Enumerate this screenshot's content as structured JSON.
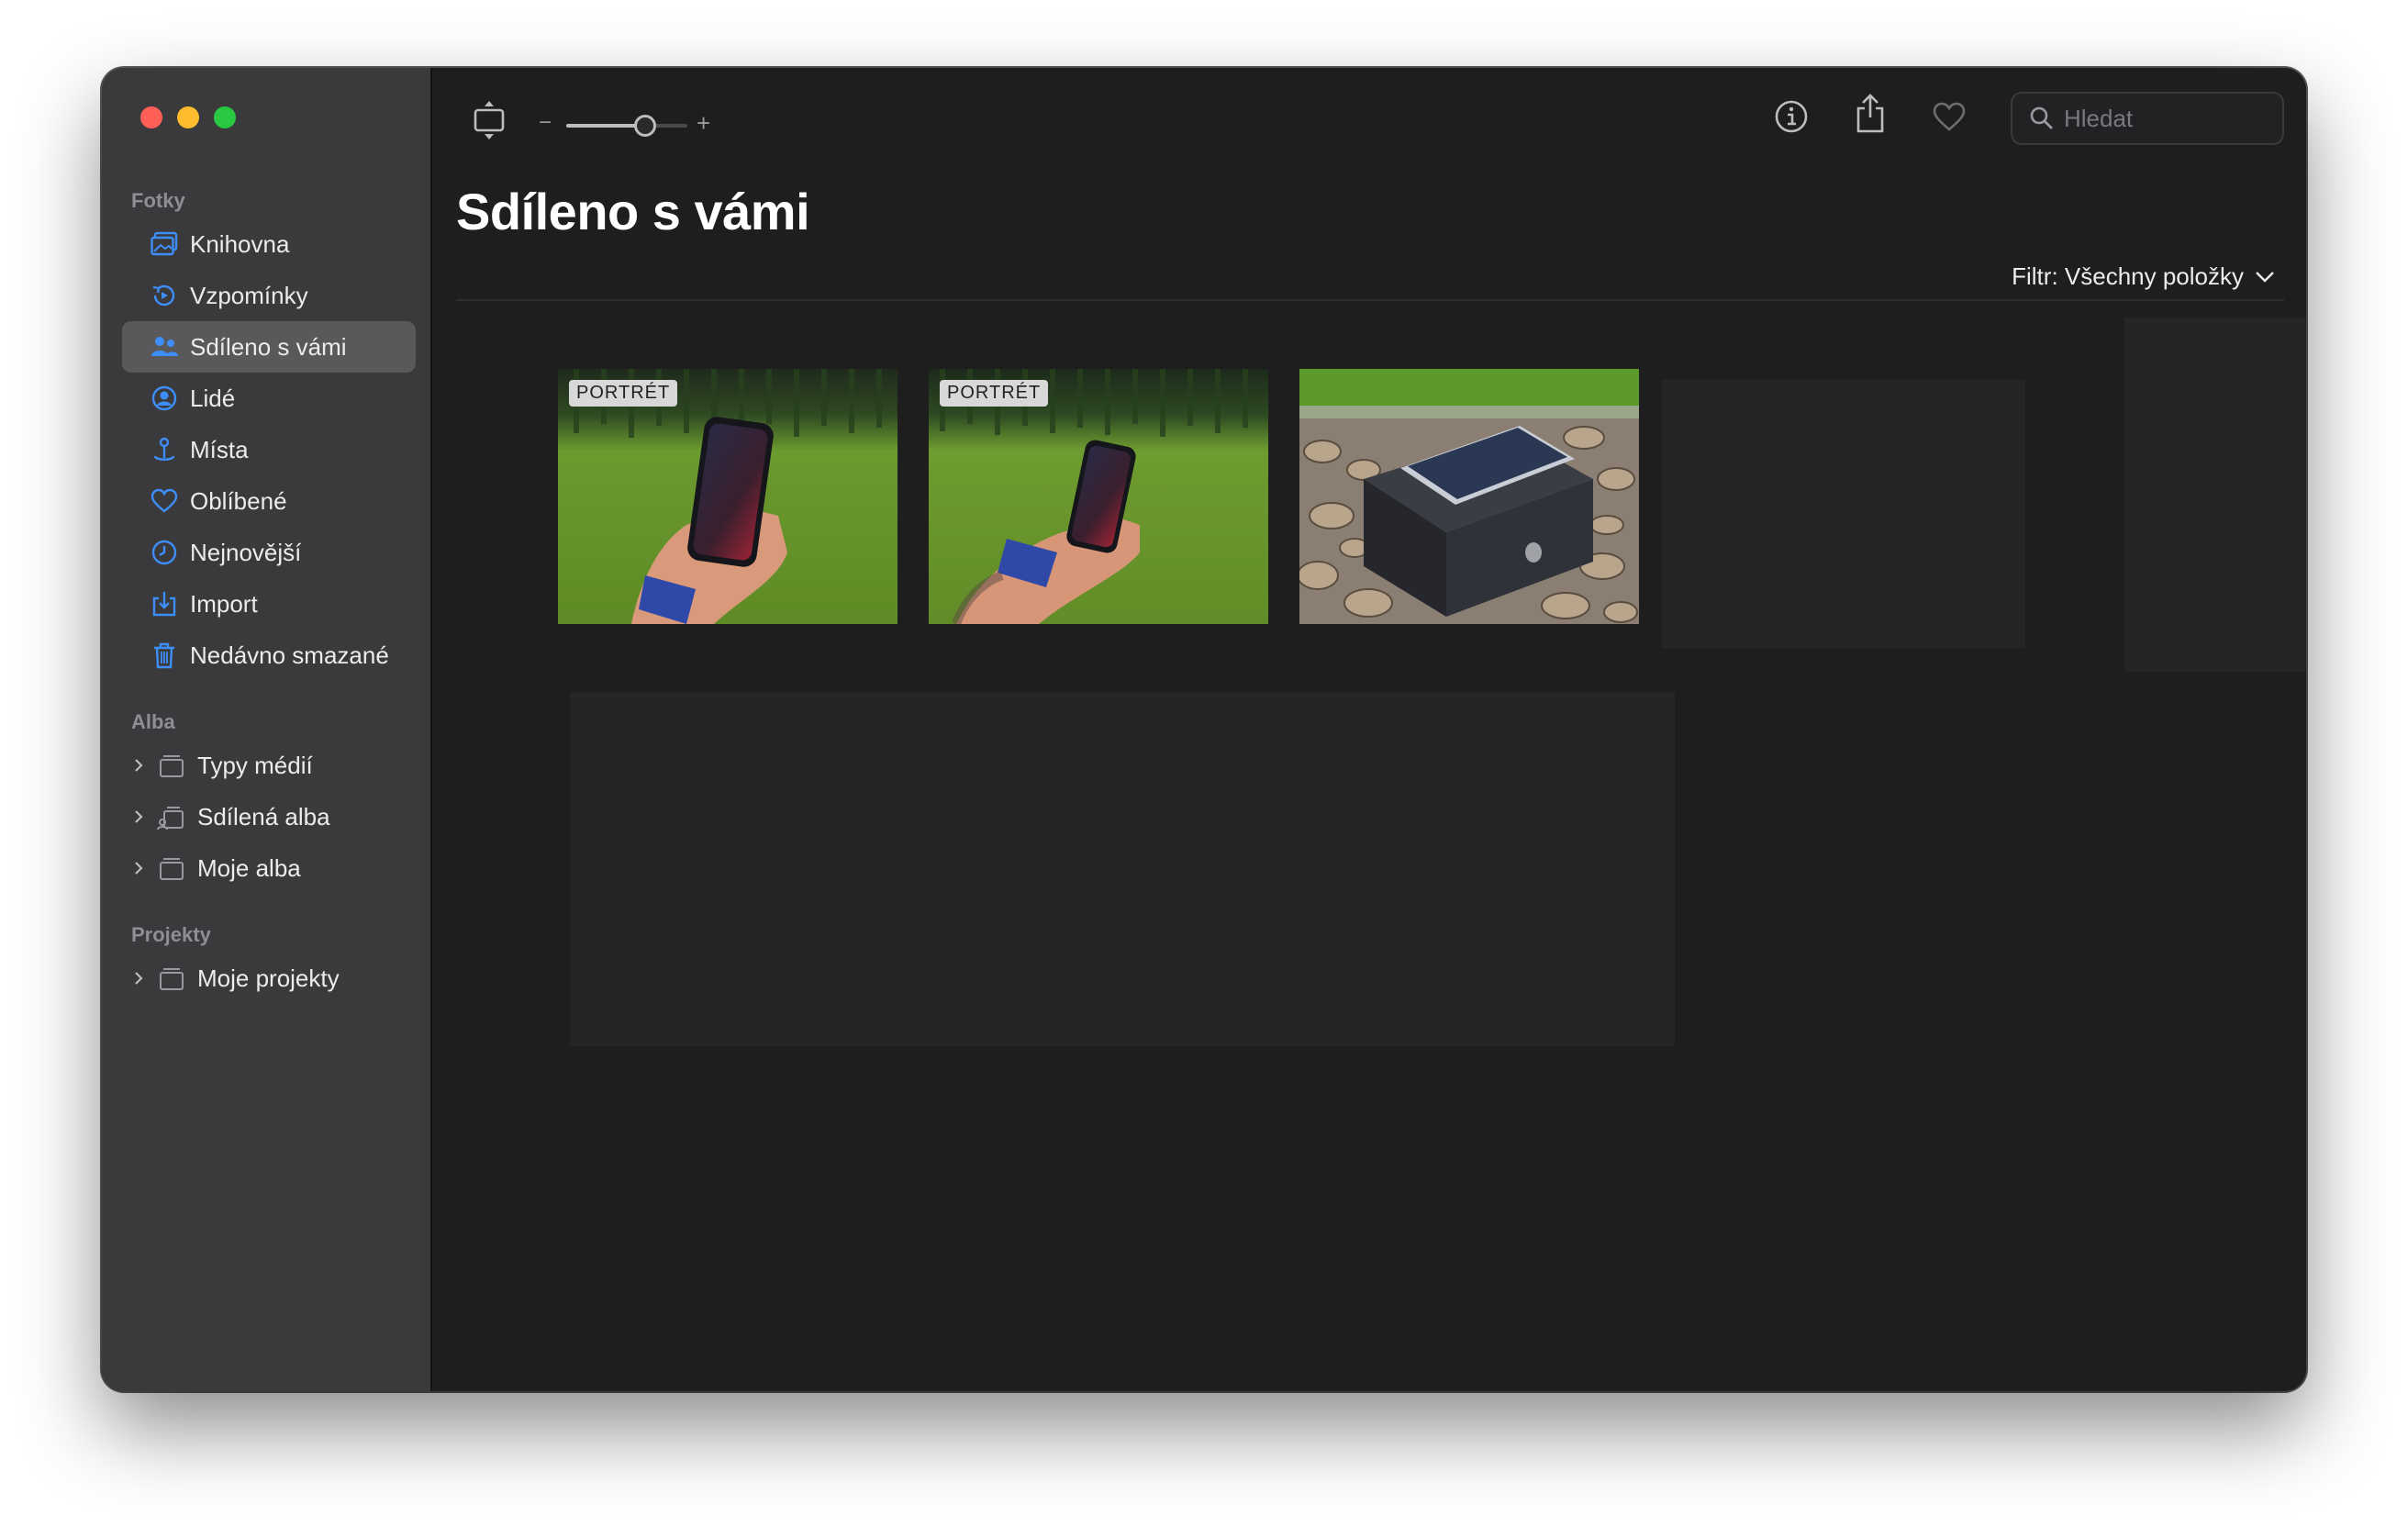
{
  "sidebar": {
    "sections": [
      {
        "label": "Fotky"
      },
      {
        "label": "Alba"
      },
      {
        "label": "Projekty"
      }
    ],
    "items": [
      {
        "label": "Knihovna",
        "icon": "photo-library-icon"
      },
      {
        "label": "Vzpomínky",
        "icon": "memories-icon"
      },
      {
        "label": "Sdíleno s vámi",
        "icon": "shared-people-icon",
        "active": true
      },
      {
        "label": "Lidé",
        "icon": "person-icon"
      },
      {
        "label": "Místa",
        "icon": "map-pin-icon"
      },
      {
        "label": "Oblíbené",
        "icon": "heart-icon"
      },
      {
        "label": "Nejnovější",
        "icon": "clock-icon"
      },
      {
        "label": "Import",
        "icon": "import-icon"
      },
      {
        "label": "Nedávno smazané",
        "icon": "trash-icon"
      }
    ],
    "albums": [
      {
        "label": "Typy médií"
      },
      {
        "label": "Sdílená alba"
      },
      {
        "label": "Moje alba"
      }
    ],
    "projects": [
      {
        "label": "Moje projekty"
      }
    ]
  },
  "toolbar": {
    "zoom_minus": "−",
    "zoom_plus": "+",
    "zoom_level": 0.65,
    "search_placeholder": "Hledat"
  },
  "main": {
    "title": "Sdíleno s vámi",
    "filter_label": "Filtr: Všechny položky",
    "photos": [
      {
        "badge": "PORTRÉT",
        "subject": "hand holding phone on lawn"
      },
      {
        "badge": "PORTRÉT",
        "subject": "hand holding phone on lawn"
      },
      {
        "badge": "",
        "subject": "phone on box on pebbles"
      }
    ]
  },
  "colors": {
    "accent": "#3d8ef8",
    "sidebar_bg": "#3a3a3c",
    "main_bg": "#1e1e1f"
  }
}
